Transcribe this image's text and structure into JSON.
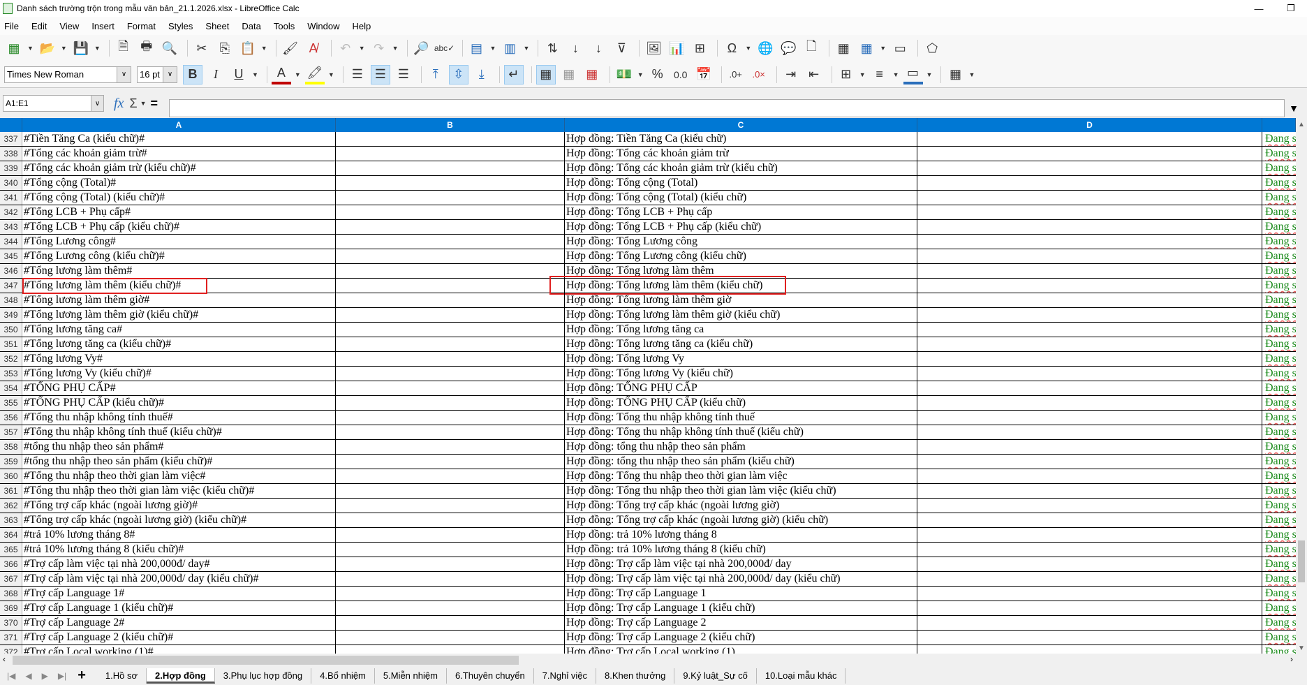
{
  "window": {
    "title": "Danh sách trường trộn trong mẫu văn bản_21.1.2026.xlsx - LibreOffice Calc",
    "minimize": "—",
    "restore": "❐"
  },
  "menu": [
    "File",
    "Edit",
    "View",
    "Insert",
    "Format",
    "Styles",
    "Sheet",
    "Data",
    "Tools",
    "Window",
    "Help"
  ],
  "toolbar": {
    "font_name": "Times New Roman",
    "font_size": "16 pt",
    "bold": "B",
    "italic": "I",
    "underline": "U",
    "font_color": "#c00000",
    "highlight_color": "#ffff00"
  },
  "formula_bar": {
    "name_box": "A1:E1",
    "fx": "fx",
    "sum": "Σ",
    "equals": "=",
    "value": ""
  },
  "columns": [
    "A",
    "B",
    "C",
    "D"
  ],
  "header_color": "#0078d4",
  "rows": [
    {
      "n": "337",
      "a": "#Tiền Tăng Ca (kiểu chữ)#",
      "c": "Hợp đồng: Tiền Tăng Ca (kiểu chữ)",
      "e": "Đang sử"
    },
    {
      "n": "338",
      "a": "#Tổng các khoản giảm trừ#",
      "c": "Hợp đồng: Tổng các khoản giảm trừ",
      "e": "Đang sử"
    },
    {
      "n": "339",
      "a": "#Tổng các khoản giảm trừ (kiểu chữ)#",
      "c": "Hợp đồng: Tổng các khoản giảm trừ (kiểu chữ)",
      "e": "Đang sử"
    },
    {
      "n": "340",
      "a": "#Tổng cộng (Total)#",
      "c": "Hợp đồng: Tổng cộng (Total)",
      "e": "Đang sử"
    },
    {
      "n": "341",
      "a": "#Tổng cộng (Total) (kiểu chữ)#",
      "c": "Hợp đồng: Tổng cộng (Total) (kiểu chữ)",
      "e": "Đang sử"
    },
    {
      "n": "342",
      "a": "#Tổng LCB + Phụ cấp#",
      "c": "Hợp đồng: Tổng LCB + Phụ cấp",
      "e": "Đang sử"
    },
    {
      "n": "343",
      "a": "#Tổng LCB + Phụ cấp (kiểu chữ)#",
      "c": "Hợp đồng: Tổng LCB + Phụ cấp (kiểu chữ)",
      "e": "Đang sử"
    },
    {
      "n": "344",
      "a": "#Tổng Lương công#",
      "c": "Hợp đồng: Tổng Lương công",
      "e": "Đang sử"
    },
    {
      "n": "345",
      "a": "#Tổng Lương công (kiểu chữ)#",
      "c": "Hợp đồng: Tổng Lương công (kiểu chữ)",
      "e": "Đang sử"
    },
    {
      "n": "346",
      "a": "#Tổng lương làm thêm#",
      "c": "Hợp đồng: Tổng lương làm thêm",
      "e": "Đang sử"
    },
    {
      "n": "347",
      "a": "#Tổng lương làm thêm (kiểu chữ)#",
      "c": "Hợp đồng: Tổng lương làm thêm (kiểu chữ)",
      "e": "Đang sử"
    },
    {
      "n": "348",
      "a": "#Tổng lương làm thêm giờ#",
      "c": "Hợp đồng: Tổng lương làm thêm giờ",
      "e": "Đang sử"
    },
    {
      "n": "349",
      "a": "#Tổng lương làm thêm giờ (kiểu chữ)#",
      "c": "Hợp đồng: Tổng lương làm thêm giờ (kiểu chữ)",
      "e": "Đang sử"
    },
    {
      "n": "350",
      "a": "#Tổng lương tăng ca#",
      "c": "Hợp đồng: Tổng lương tăng ca",
      "e": "Đang sử"
    },
    {
      "n": "351",
      "a": "#Tổng lương tăng ca (kiểu chữ)#",
      "c": "Hợp đồng: Tổng lương tăng ca (kiểu chữ)",
      "e": "Đang sử"
    },
    {
      "n": "352",
      "a": "#Tổng lương Vy#",
      "c": "Hợp đồng: Tổng lương Vy",
      "e": "Đang sử"
    },
    {
      "n": "353",
      "a": "#Tổng lương Vy (kiểu chữ)#",
      "c": "Hợp đồng: Tổng lương Vy (kiểu chữ)",
      "e": "Đang sử"
    },
    {
      "n": "354",
      "a": "#TỔNG PHỤ CẤP#",
      "c": "Hợp đồng: TỔNG PHỤ CẤP",
      "e": "Đang sử"
    },
    {
      "n": "355",
      "a": "#TỔNG PHỤ CẤP (kiểu chữ)#",
      "c": "Hợp đồng: TỔNG PHỤ CẤP (kiểu chữ)",
      "e": "Đang sử"
    },
    {
      "n": "356",
      "a": "#Tổng thu nhập không tính thuế#",
      "c": "Hợp đồng: Tổng thu nhập không tính thuế",
      "e": "Đang sử"
    },
    {
      "n": "357",
      "a": "#Tổng thu nhập không tính thuế (kiểu chữ)#",
      "c": "Hợp đồng: Tổng thu nhập không tính thuế (kiểu chữ)",
      "e": "Đang sử"
    },
    {
      "n": "358",
      "a": "#tổng thu nhập theo sản phẩm#",
      "c": "Hợp đồng: tổng thu nhập theo sản phẩm",
      "e": "Đang sử"
    },
    {
      "n": "359",
      "a": "#tổng thu nhập theo sản phẩm (kiểu chữ)#",
      "c": "Hợp đồng: tổng thu nhập theo sản phẩm (kiểu chữ)",
      "e": "Đang sử"
    },
    {
      "n": "360",
      "a": "#Tổng thu nhập theo thời gian làm việc#",
      "c": "Hợp đồng: Tổng thu nhập theo thời gian làm việc",
      "e": "Đang sử"
    },
    {
      "n": "361",
      "a": "#Tổng thu nhập theo thời gian làm việc (kiểu chữ)#",
      "c": "Hợp đồng: Tổng thu nhập theo thời gian làm việc (kiểu chữ)",
      "e": "Đang sử"
    },
    {
      "n": "362",
      "a": "#Tổng trợ cấp khác (ngoài lương giờ)#",
      "c": "Hợp đồng: Tổng trợ cấp khác (ngoài lương giờ)",
      "e": "Đang sử"
    },
    {
      "n": "363",
      "a": "#Tổng trợ cấp khác (ngoài lương giờ) (kiểu chữ)#",
      "c": "Hợp đồng: Tổng trợ cấp khác (ngoài lương giờ) (kiểu chữ)",
      "e": "Đang sử"
    },
    {
      "n": "364",
      "a": "#trả 10% lương tháng 8#",
      "c": "Hợp đồng: trả 10% lương tháng 8",
      "e": "Đang sử"
    },
    {
      "n": "365",
      "a": "#trả 10% lương tháng 8 (kiểu chữ)#",
      "c": "Hợp đồng: trả 10% lương tháng 8 (kiểu chữ)",
      "e": "Đang sử"
    },
    {
      "n": "366",
      "a": "#Trợ cấp làm việc tại nhà 200,000đ/ day#",
      "c": "Hợp đồng: Trợ cấp làm việc tại nhà 200,000đ/ day",
      "e": "Đang sử"
    },
    {
      "n": "367",
      "a": "#Trợ cấp làm việc tại nhà 200,000đ/ day (kiểu chữ)#",
      "c": "Hợp đồng: Trợ cấp làm việc tại nhà 200,000đ/ day (kiểu chữ)",
      "e": "Đang sử"
    },
    {
      "n": "368",
      "a": "#Trợ cấp Language 1#",
      "c": "Hợp đồng: Trợ cấp Language 1",
      "e": "Đang sử"
    },
    {
      "n": "369",
      "a": "#Trợ cấp Language 1 (kiểu chữ)#",
      "c": "Hợp đồng: Trợ cấp Language 1 (kiểu chữ)",
      "e": "Đang sử"
    },
    {
      "n": "370",
      "a": "#Trợ cấp Language 2#",
      "c": "Hợp đồng: Trợ cấp Language 2",
      "e": "Đang sử"
    },
    {
      "n": "371",
      "a": "#Trợ cấp Language 2 (kiểu chữ)#",
      "c": "Hợp đồng: Trợ cấp Language 2 (kiểu chữ)",
      "e": "Đang sử"
    },
    {
      "n": "372",
      "a": "#Trợ cấp Local working (1)#",
      "c": "Hợp đồng: Trợ cấp Local working (1)",
      "e": "Đang sử"
    }
  ],
  "highlighted_row": "347",
  "sheet_tabs": [
    "1.Hồ sơ",
    "2.Hợp đồng",
    "3.Phụ lục hợp đồng",
    "4.Bổ nhiệm",
    "5.Miễn nhiệm",
    "6.Thuyên chuyển",
    "7.Nghỉ việc",
    "8.Khen thưởng",
    "9.Kỷ luật_Sự cố",
    "10.Loại mẫu khác"
  ],
  "active_tab": "2.Hợp đồng"
}
